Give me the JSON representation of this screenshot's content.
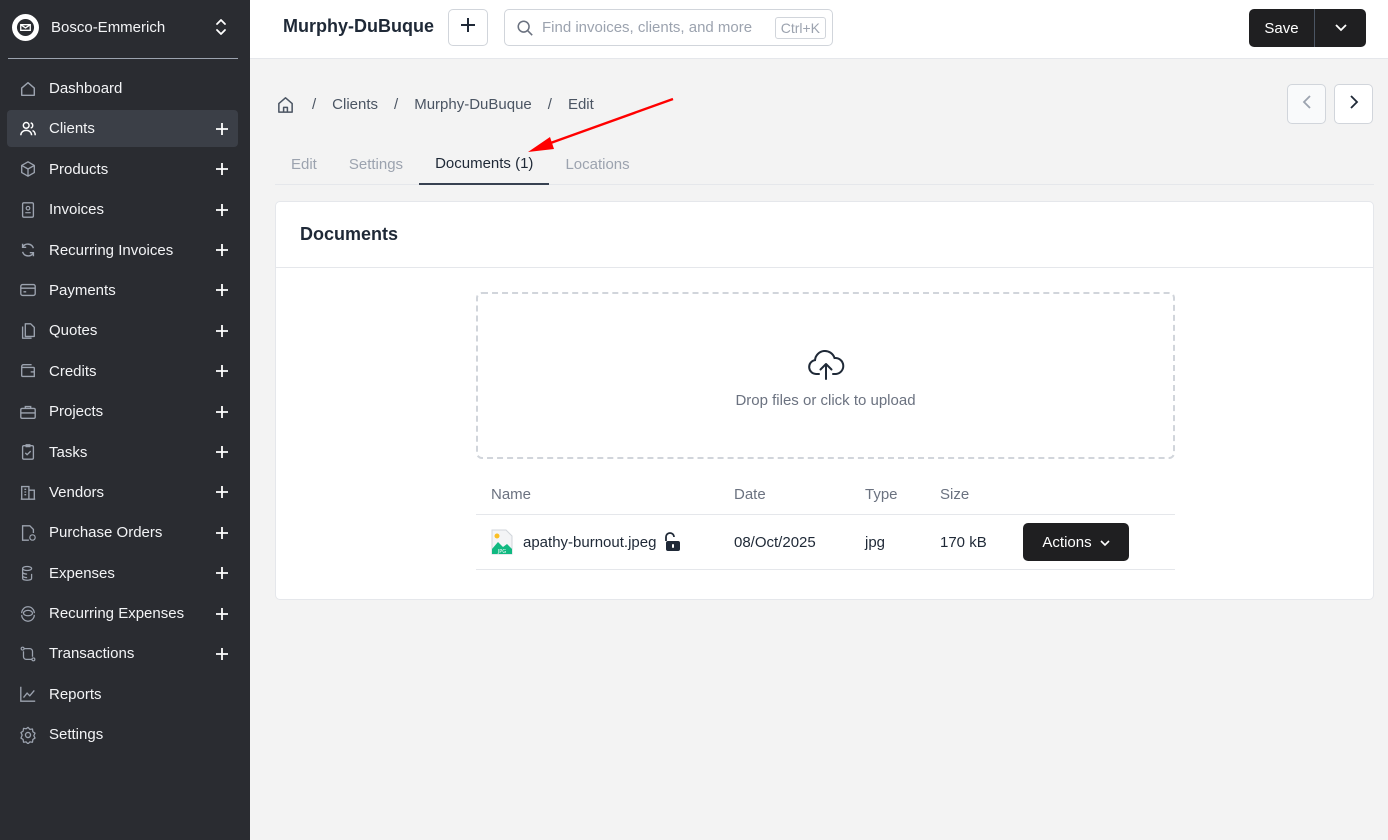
{
  "company": {
    "name": "Bosco-Emmerich"
  },
  "sidebar": {
    "items": [
      {
        "label": "Dashboard",
        "icon": "home-icon",
        "has_add": false,
        "active": false
      },
      {
        "label": "Clients",
        "icon": "users-icon",
        "has_add": true,
        "active": true
      },
      {
        "label": "Products",
        "icon": "box-icon",
        "has_add": true,
        "active": false
      },
      {
        "label": "Invoices",
        "icon": "file-invoice-icon",
        "has_add": true,
        "active": false
      },
      {
        "label": "Recurring Invoices",
        "icon": "refresh-icon",
        "has_add": true,
        "active": false
      },
      {
        "label": "Payments",
        "icon": "credit-card-icon",
        "has_add": true,
        "active": false
      },
      {
        "label": "Quotes",
        "icon": "files-icon",
        "has_add": true,
        "active": false
      },
      {
        "label": "Credits",
        "icon": "wallet-icon",
        "has_add": true,
        "active": false
      },
      {
        "label": "Projects",
        "icon": "briefcase-icon",
        "has_add": true,
        "active": false
      },
      {
        "label": "Tasks",
        "icon": "clipboard-check-icon",
        "has_add": true,
        "active": false
      },
      {
        "label": "Vendors",
        "icon": "building-icon",
        "has_add": true,
        "active": false
      },
      {
        "label": "Purchase Orders",
        "icon": "file-clock-icon",
        "has_add": true,
        "active": false
      },
      {
        "label": "Expenses",
        "icon": "coins-icon",
        "has_add": true,
        "active": false
      },
      {
        "label": "Recurring Expenses",
        "icon": "coins-refresh-icon",
        "has_add": true,
        "active": false
      },
      {
        "label": "Transactions",
        "icon": "transfer-icon",
        "has_add": true,
        "active": false
      },
      {
        "label": "Reports",
        "icon": "chart-line-icon",
        "has_add": false,
        "active": false
      },
      {
        "label": "Settings",
        "icon": "gear-icon",
        "has_add": false,
        "active": false
      }
    ]
  },
  "topbar": {
    "title": "Murphy-DuBuque",
    "search_placeholder": "Find invoices, clients, and more",
    "search_shortcut": "Ctrl+K",
    "save_label": "Save"
  },
  "breadcrumb": {
    "items": [
      "Clients",
      "Murphy-DuBuque",
      "Edit"
    ]
  },
  "tabs": [
    {
      "label": "Edit",
      "active": false
    },
    {
      "label": "Settings",
      "active": false
    },
    {
      "label": "Documents (1)",
      "active": true
    },
    {
      "label": "Locations",
      "active": false
    }
  ],
  "documents": {
    "title": "Documents",
    "dropzone_text": "Drop files or click to upload",
    "columns": [
      "Name",
      "Date",
      "Type",
      "Size"
    ],
    "rows": [
      {
        "name": "apathy-burnout.jpeg",
        "date": "08/Oct/2025",
        "type": "jpg",
        "size": "170 kB",
        "actions_label": "Actions",
        "file_badge": "JPG"
      }
    ]
  },
  "colors": {
    "sidebar_bg": "#2a2c31",
    "sidebar_active": "#3b3f47",
    "primary_button": "#1f1f21",
    "annotation_arrow": "#ff0000"
  }
}
